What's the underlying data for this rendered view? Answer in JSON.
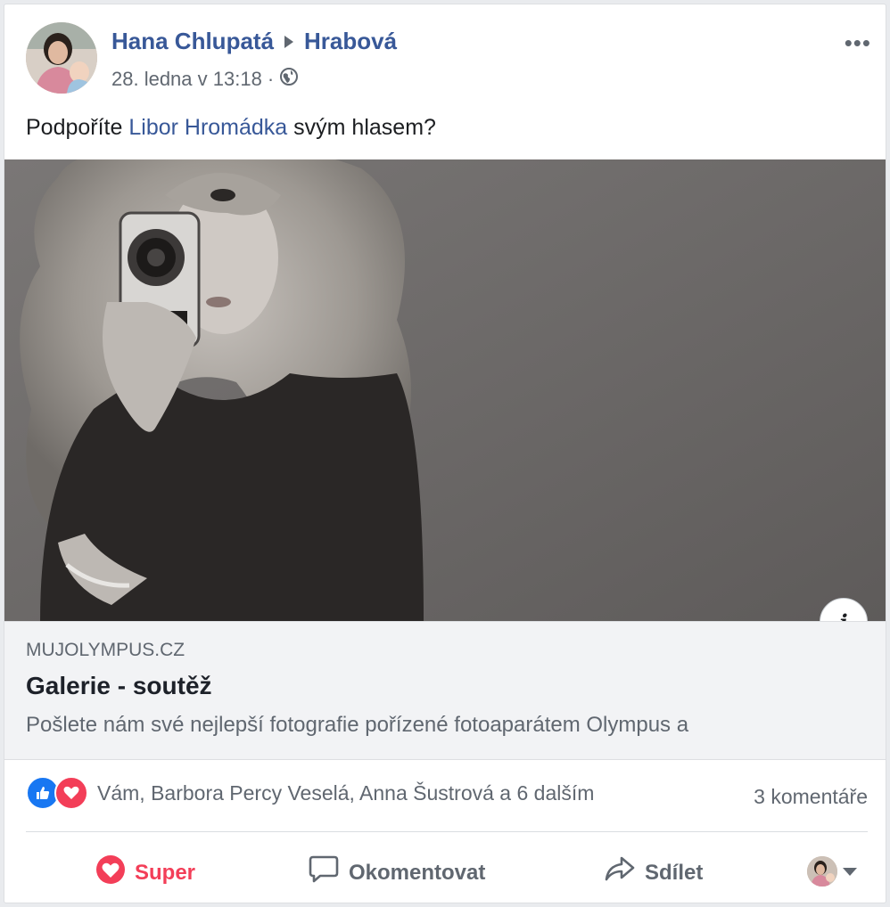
{
  "post": {
    "author_name": "Hana Chlupatá",
    "target_name": "Hrabová",
    "timestamp": "28. ledna v 13:18",
    "separator": "·",
    "privacy_icon": "globe-icon",
    "more_label": "•••",
    "text_before": "Podpoříte ",
    "mention": "Libor Hromádka",
    "text_after": " svým hlasem?"
  },
  "link_preview": {
    "info_label": "i",
    "domain": "MUJOLYMPUS.CZ",
    "title": "Galerie - soutěž",
    "description": "Pošlete nám své nejlepší fotografie pořízené fotoaparátem Olympus a"
  },
  "reactions": {
    "icons": [
      "like-icon",
      "love-icon"
    ],
    "summary": "Vám, Barbora Percy Veselá, Anna Šustrová a 6 dalším",
    "comments_count": "3 komentáře"
  },
  "actions": {
    "super_label": "Super",
    "comment_label": "Okomentovat",
    "share_label": "Sdílet"
  },
  "colors": {
    "link": "#385898",
    "love": "#f33e58",
    "like": "#1877f2",
    "muted": "#606770"
  }
}
